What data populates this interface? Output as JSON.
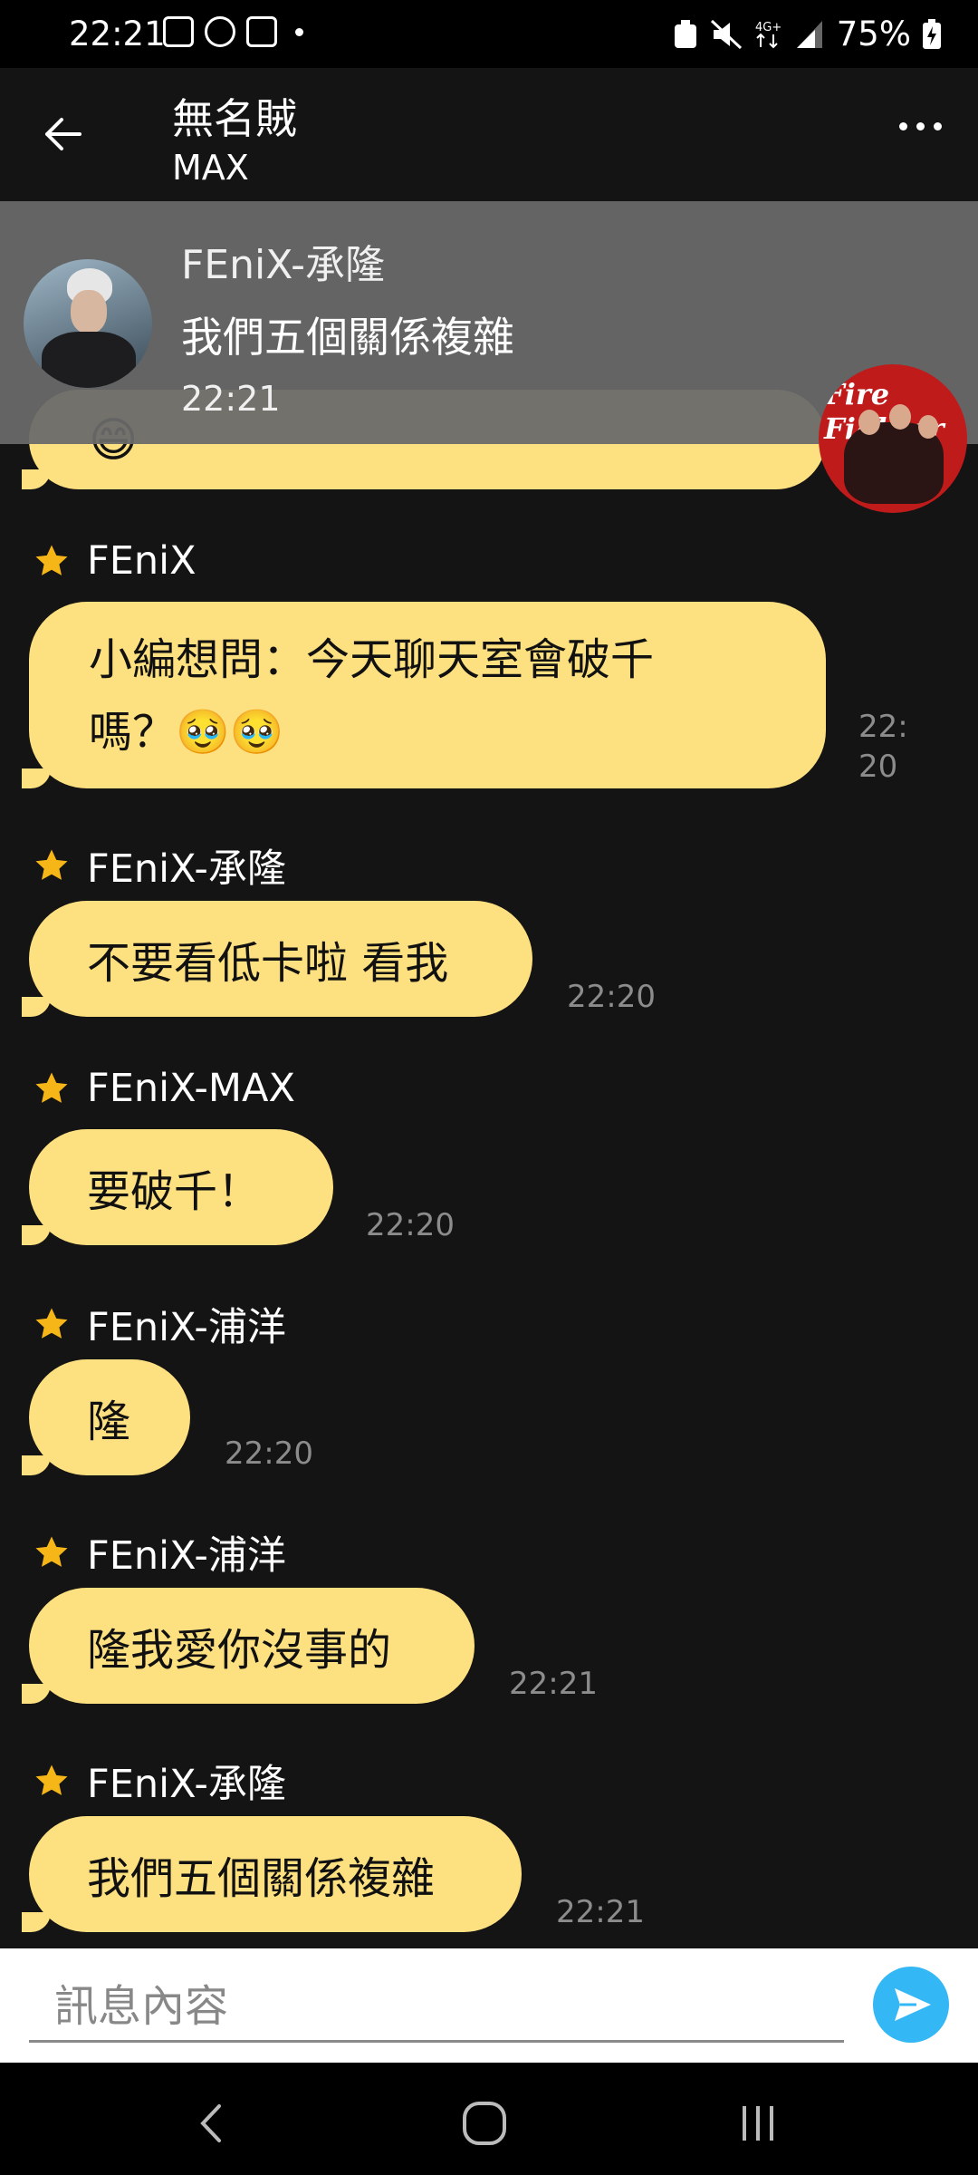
{
  "status": {
    "time": "22:21",
    "battery": "75%"
  },
  "header": {
    "title": "無名賊",
    "subtitle": "MAX"
  },
  "notification": {
    "sender": "FEniX-承隆",
    "text": "我們五個關係複雜",
    "time": "22:21"
  },
  "messages": [
    {
      "name": "FEniX",
      "text": "小編想問：今天聊天室會破千嗎？🥹🥹",
      "line1": "小編想問：今天聊天室會破千",
      "line2": "嗎？🥹🥹",
      "time_line1": "22:",
      "time_line2": "20"
    },
    {
      "name": "FEniX-承隆",
      "text": "不要看低卡啦 看我",
      "time": "22:20"
    },
    {
      "name": "FEniX-MAX",
      "text": "要破千！",
      "time": "22:20"
    },
    {
      "name": "FEniX-浦洋",
      "text": "隆",
      "time": "22:20"
    },
    {
      "name": "FEniX-浦洋",
      "text": "隆我愛你沒事的",
      "time": "22:21"
    },
    {
      "name": "FEniX-承隆",
      "text": "我們五個關係複雜",
      "time": "22:21"
    }
  ],
  "partial_bubble_emoji": "😄",
  "side_avatar_text": "Fire Fighter",
  "input": {
    "placeholder": "訊息內容"
  },
  "colors": {
    "bubble": "#fde080",
    "send": "#33b7f5",
    "background": "#141414"
  },
  "icons": [
    "back-arrow-icon",
    "more-icon",
    "star-icon",
    "send-icon",
    "nav-back-icon",
    "nav-home-icon",
    "nav-recents-icon"
  ]
}
